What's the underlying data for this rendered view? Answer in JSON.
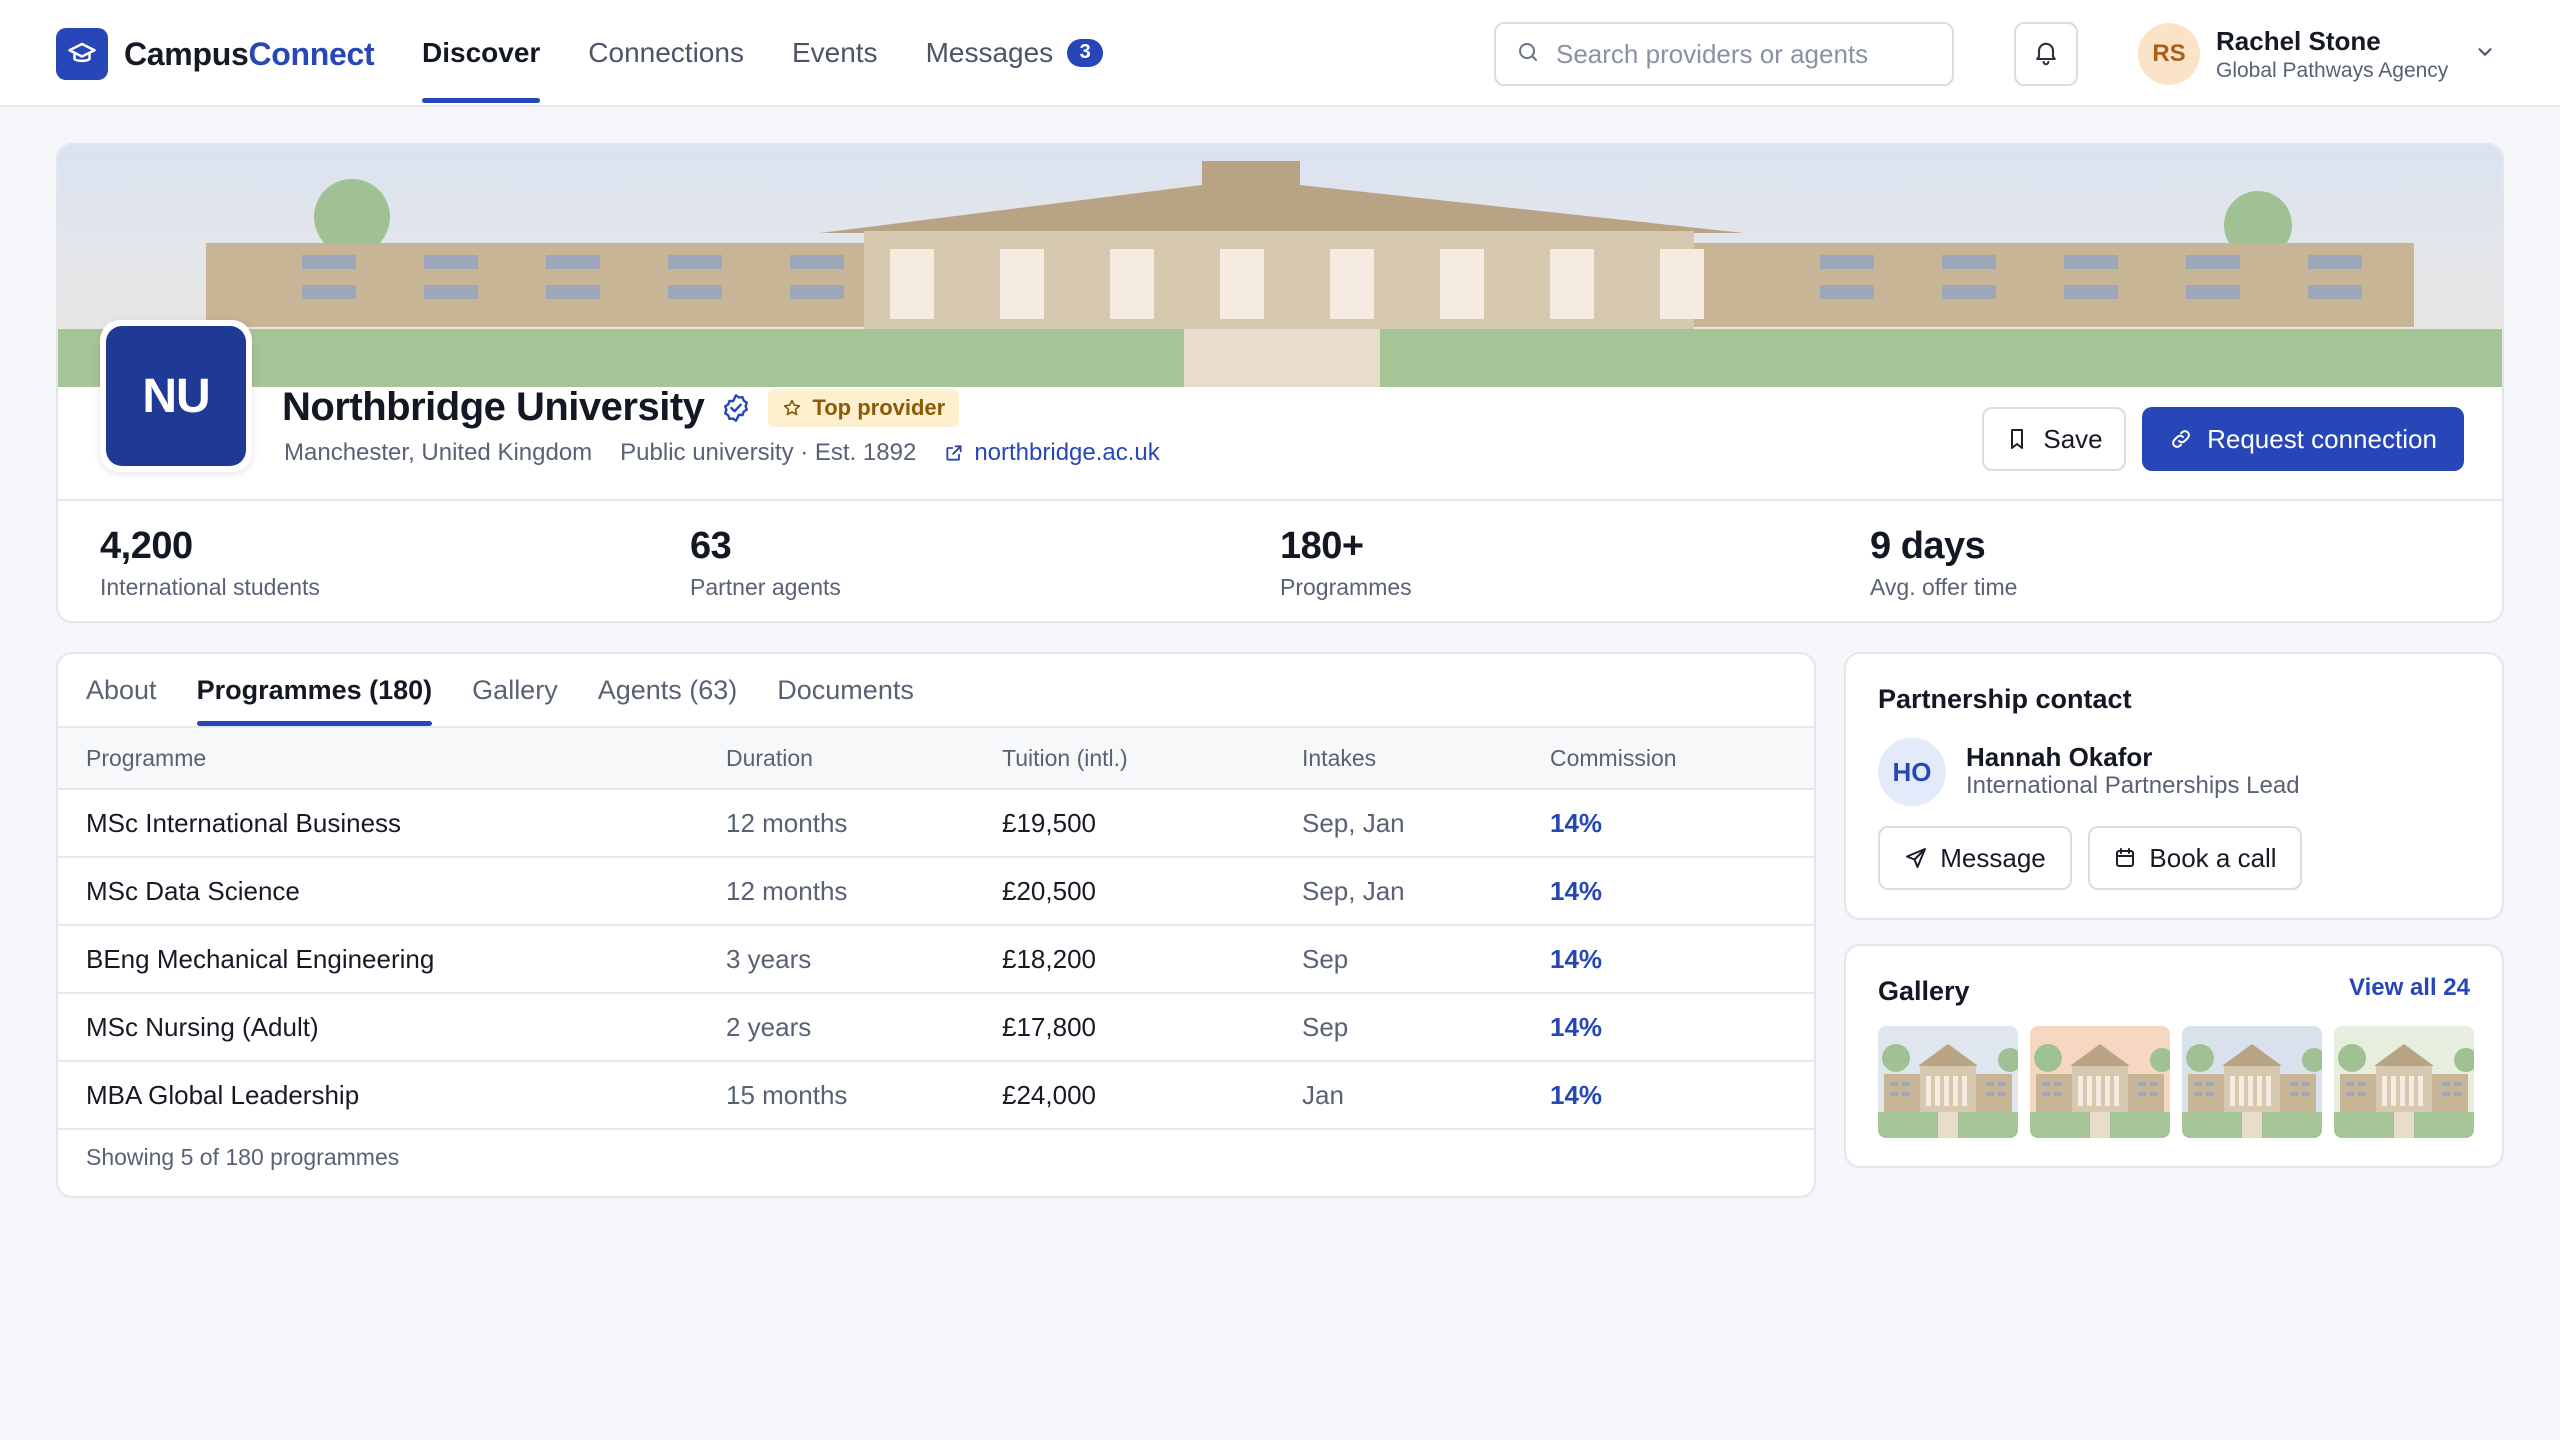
{
  "app": {
    "logo_part1": "Campus",
    "logo_part2": "Connect",
    "logo_icon": "graduation-cap-icon",
    "accent": "#2747b8"
  },
  "nav": {
    "items": [
      {
        "label": "Discover",
        "active": true
      },
      {
        "label": "Connections"
      },
      {
        "label": "Events"
      },
      {
        "label": "Messages",
        "badge": "3"
      }
    ]
  },
  "search": {
    "placeholder": "Search providers or agents",
    "value": ""
  },
  "user": {
    "initials": "RS",
    "name": "Rachel Stone",
    "org": "Global Pathways Agency"
  },
  "profile": {
    "logo_initials": "NU",
    "name": "Northbridge University",
    "verified_icon": "verified-badge-icon",
    "badge": "Top provider",
    "location": "Manchester, United Kingdom",
    "type": "Public university · Est. 1892",
    "website": "northbridge.ac.uk",
    "save_label": "Save",
    "request_label": "Request connection",
    "stats": [
      {
        "value": "4,200",
        "label": "International students"
      },
      {
        "value": "63",
        "label": "Partner agents"
      },
      {
        "value": "180+",
        "label": "Programmes"
      },
      {
        "value": "9 days",
        "label": "Avg. offer time"
      }
    ]
  },
  "tabs": [
    {
      "label": "About"
    },
    {
      "label": "Programmes (180)",
      "active": true
    },
    {
      "label": "Gallery"
    },
    {
      "label": "Agents (63)"
    },
    {
      "label": "Documents"
    }
  ],
  "programmes": {
    "columns": [
      "Programme",
      "Duration",
      "Tuition (intl.)",
      "Intakes",
      "Commission"
    ],
    "rows": [
      {
        "name": "MSc International Business",
        "duration": "12 months",
        "tuition": "£19,500",
        "intakes": "Sep, Jan",
        "commission": "14%"
      },
      {
        "name": "MSc Data Science",
        "duration": "12 months",
        "tuition": "£20,500",
        "intakes": "Sep, Jan",
        "commission": "14%"
      },
      {
        "name": "BEng Mechanical Engineering",
        "duration": "3 years",
        "tuition": "£18,200",
        "intakes": "Sep",
        "commission": "14%"
      },
      {
        "name": "MSc Nursing (Adult)",
        "duration": "2 years",
        "tuition": "£17,800",
        "intakes": "Sep",
        "commission": "14%"
      },
      {
        "name": "MBA Global Leadership",
        "duration": "15 months",
        "tuition": "£24,000",
        "intakes": "Jan",
        "commission": "14%"
      }
    ],
    "footer": "Showing 5 of 180 programmes"
  },
  "contact": {
    "title": "Partnership contact",
    "initials": "HO",
    "name": "Hannah Okafor",
    "role": "International Partnerships Lead",
    "message_label": "Message",
    "call_label": "Book a call"
  },
  "gallery": {
    "title": "Gallery",
    "view_all": "View all 24",
    "thumb_skies": [
      "#dfe6ee",
      "#f6d7c2",
      "#d9e1ec",
      "#e7eedd"
    ]
  }
}
